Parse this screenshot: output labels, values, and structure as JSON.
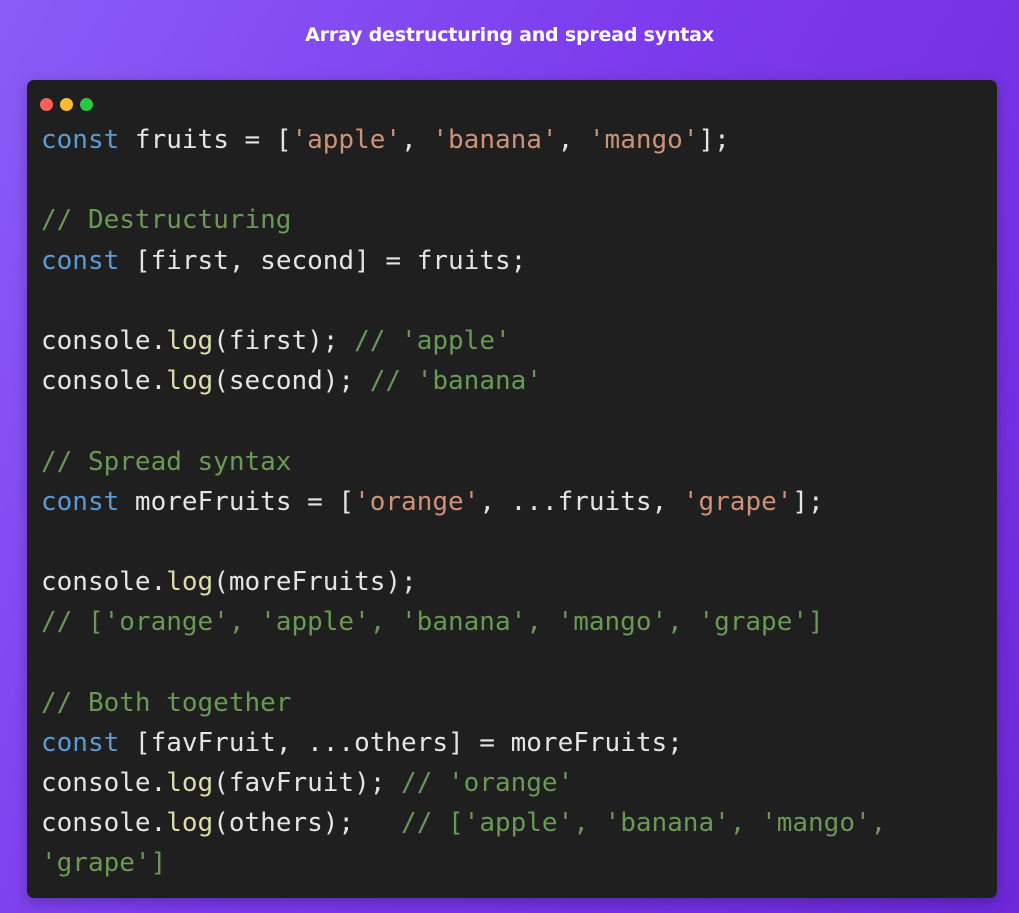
{
  "title": "Array destructuring and spread syntax",
  "window": {
    "controls": [
      "close",
      "minimize",
      "maximize"
    ]
  },
  "colors": {
    "background_start": "#8b5cf6",
    "background_end": "#6d28d9",
    "editor_background": "#1f1f1f",
    "keyword": "#5a9bd5",
    "string": "#cf9178",
    "comment": "#6a9955",
    "function": "#dcdcaa",
    "plain": "#e4e4e4"
  },
  "code": {
    "l1": {
      "kw": "const",
      "a": " fruits = [",
      "s1": "'apple'",
      "b": ", ",
      "s2": "'banana'",
      "c": ", ",
      "s3": "'mango'",
      "d": "];"
    },
    "l3": {
      "com": "// Destructuring"
    },
    "l4": {
      "kw": "const",
      "a": " [first, second] = fruits;"
    },
    "l6": {
      "a": "console.",
      "fn": "log",
      "b": "(first); ",
      "com": "// 'apple'"
    },
    "l7": {
      "a": "console.",
      "fn": "log",
      "b": "(second); ",
      "com": "// 'banana'"
    },
    "l9": {
      "com": "// Spread syntax"
    },
    "l10": {
      "kw": "const",
      "a": " moreFruits = [",
      "s1": "'orange'",
      "b": ", ...fruits, ",
      "s2": "'grape'",
      "c": "];"
    },
    "l12": {
      "a": "console.",
      "fn": "log",
      "b": "(moreFruits);"
    },
    "l13": {
      "com": "// ['orange', 'apple', 'banana', 'mango', 'grape']"
    },
    "l15": {
      "com": "// Both together"
    },
    "l16": {
      "kw": "const",
      "a": " [favFruit, ...others] = moreFruits;"
    },
    "l17": {
      "a": "console.",
      "fn": "log",
      "b": "(favFruit); ",
      "com": "// 'orange'"
    },
    "l18": {
      "a": "console.",
      "fn": "log",
      "b": "(others);   ",
      "com": "// ['apple', 'banana', 'mango',\n'grape']"
    }
  }
}
